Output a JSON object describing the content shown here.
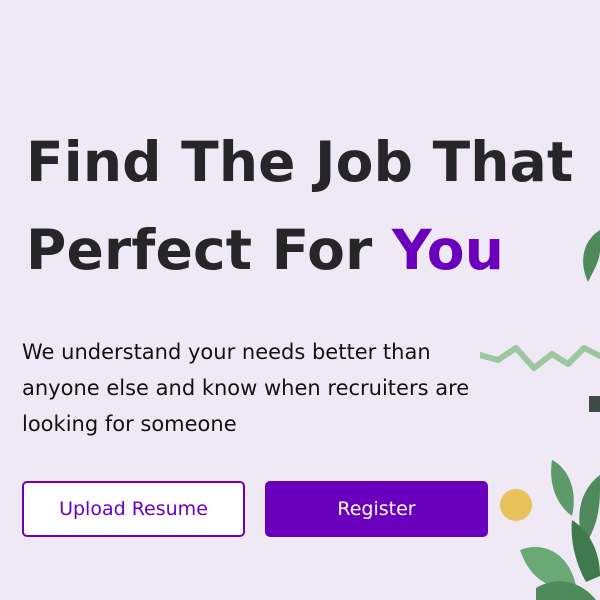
{
  "hero": {
    "title_line1": "Find The Job That",
    "title_line2_prefix": "Perfect For ",
    "title_line2_accent": "You",
    "subtitle": "We understand your needs better than anyone else and know when recruiters are looking for someone"
  },
  "actions": {
    "upload_resume_label": "Upload Resume",
    "register_label": "Register"
  },
  "colors": {
    "background": "#efe9f5",
    "accent": "#6a00bd",
    "heading": "#262629",
    "leaf": "#4e8a5c",
    "zigzag": "#9cc7a0",
    "sun": "#e8c15a"
  },
  "decoration": {
    "icons": [
      "zigzag-line-icon",
      "leaf-plant-icon",
      "sun-circle-icon"
    ]
  }
}
